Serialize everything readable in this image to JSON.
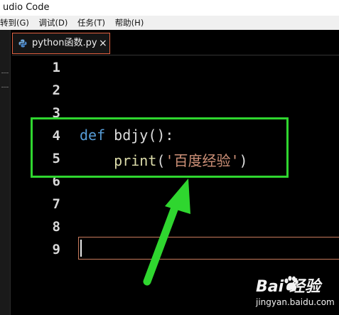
{
  "window": {
    "title": "udio Code"
  },
  "menu": {
    "items": [
      "转到(G)",
      "调试(D)",
      "任务(T)",
      "帮助(H)"
    ]
  },
  "tab": {
    "label": "python函数.py",
    "close": "×"
  },
  "editor": {
    "line_numbers": [
      "1",
      "2",
      "3",
      "4",
      "5",
      "6",
      "7",
      "8",
      "9"
    ],
    "line4": {
      "kw": "def",
      "fn": " bdjy():"
    },
    "line5": {
      "indent": "    ",
      "builtin": "print",
      "open": "(",
      "string": "'百度经验'",
      "close": ")"
    }
  },
  "colors": {
    "highlight": "#2fd62f",
    "keyword": "#569cd6",
    "string": "#ce9178",
    "builtin": "#dcdcaa"
  },
  "watermark": {
    "brand": "Bai  经验",
    "url": "jingyan.baidu.com"
  }
}
